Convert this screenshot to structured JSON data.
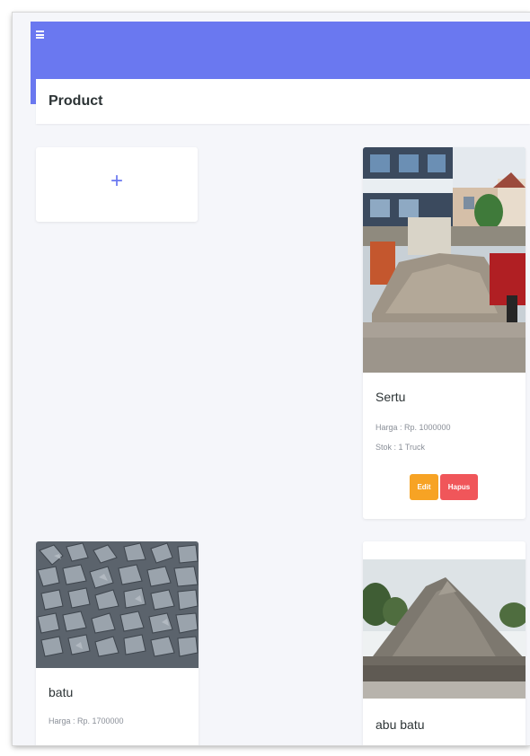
{
  "header": {
    "menu_icon": "hamburger-icon"
  },
  "page": {
    "title": "Product"
  },
  "add_card": {
    "icon": "plus-icon",
    "label": "+"
  },
  "products": [
    {
      "name": "Sertu",
      "price": "Harga : Rp. 1000000",
      "stock": "Stok : 1 Truck",
      "edit_label": "Edit",
      "delete_label": "Hapus",
      "image": "pile of sand and soil at construction site"
    },
    {
      "name": "batu",
      "price": "Harga : Rp. 1700000",
      "image": "crushed gray stones"
    },
    {
      "name": "abu batu",
      "image": "mound of stone dust"
    }
  ],
  "colors": {
    "primary": "#6a78f0",
    "edit": "#f7a324",
    "delete": "#f0565a",
    "background": "#f5f6fa"
  }
}
